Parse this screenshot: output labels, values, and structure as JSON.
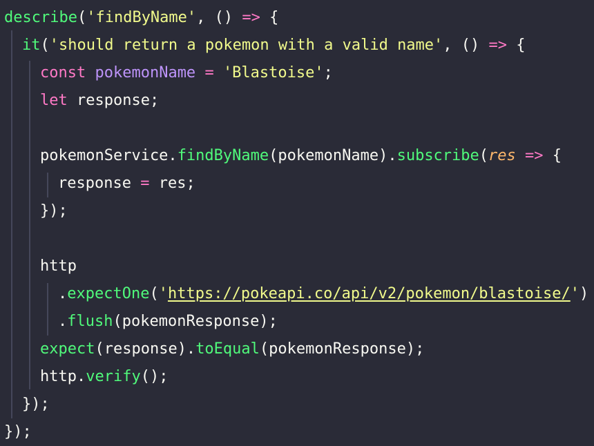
{
  "editor": {
    "language": "javascript",
    "colors": {
      "background": "#2a2b37",
      "plain": "#f8f8f2",
      "function": "#50fa7b",
      "string": "#f1fa8c",
      "keyword": "#ff79c6",
      "variable": "#bd93f9",
      "parameter": "#ffb86c",
      "indent_guide": "#45475a"
    },
    "lines": [
      {
        "tokens": [
          {
            "type": "fn",
            "text": "describe"
          },
          {
            "type": "plain",
            "text": "("
          },
          {
            "type": "str",
            "text": "'findByName'"
          },
          {
            "type": "plain",
            "text": ", () "
          },
          {
            "type": "op",
            "text": "=>"
          },
          {
            "type": "plain",
            "text": " {"
          }
        ]
      },
      {
        "tokens": [
          {
            "type": "fn",
            "text": "it"
          },
          {
            "type": "plain",
            "text": "("
          },
          {
            "type": "str",
            "text": "'should return a pokemon with a valid name'"
          },
          {
            "type": "plain",
            "text": ", () "
          },
          {
            "type": "op",
            "text": "=>"
          },
          {
            "type": "plain",
            "text": " {"
          }
        ]
      },
      {
        "tokens": [
          {
            "type": "kw",
            "text": "const"
          },
          {
            "type": "plain",
            "text": " "
          },
          {
            "type": "var",
            "text": "pokemonName"
          },
          {
            "type": "plain",
            "text": " "
          },
          {
            "type": "op",
            "text": "="
          },
          {
            "type": "plain",
            "text": " "
          },
          {
            "type": "str",
            "text": "'Blastoise'"
          },
          {
            "type": "plain",
            "text": ";"
          }
        ]
      },
      {
        "tokens": [
          {
            "type": "kw",
            "text": "let"
          },
          {
            "type": "plain",
            "text": " response;"
          }
        ]
      },
      {
        "tokens": []
      },
      {
        "tokens": [
          {
            "type": "plain",
            "text": "pokemonService."
          },
          {
            "type": "fn",
            "text": "findByName"
          },
          {
            "type": "plain",
            "text": "(pokemonName)."
          },
          {
            "type": "fn",
            "text": "subscribe"
          },
          {
            "type": "plain",
            "text": "("
          },
          {
            "type": "param",
            "text": "res"
          },
          {
            "type": "plain",
            "text": " "
          },
          {
            "type": "op",
            "text": "=>"
          },
          {
            "type": "plain",
            "text": " {"
          }
        ]
      },
      {
        "tokens": [
          {
            "type": "plain",
            "text": "response "
          },
          {
            "type": "op",
            "text": "="
          },
          {
            "type": "plain",
            "text": " res;"
          }
        ]
      },
      {
        "tokens": [
          {
            "type": "plain",
            "text": "});"
          }
        ]
      },
      {
        "tokens": []
      },
      {
        "tokens": [
          {
            "type": "plain",
            "text": "http"
          }
        ]
      },
      {
        "tokens": [
          {
            "type": "plain",
            "text": "."
          },
          {
            "type": "fn",
            "text": "expectOne"
          },
          {
            "type": "plain",
            "text": "("
          },
          {
            "type": "str",
            "text": "'"
          },
          {
            "type": "url",
            "text": "https://pokeapi.co/api/v2/pokemon/blastoise/"
          },
          {
            "type": "str",
            "text": "'"
          },
          {
            "type": "plain",
            "text": ")"
          }
        ]
      },
      {
        "tokens": [
          {
            "type": "plain",
            "text": "."
          },
          {
            "type": "fn",
            "text": "flush"
          },
          {
            "type": "plain",
            "text": "(pokemonResponse);"
          }
        ]
      },
      {
        "tokens": [
          {
            "type": "fn",
            "text": "expect"
          },
          {
            "type": "plain",
            "text": "(response)."
          },
          {
            "type": "fn",
            "text": "toEqual"
          },
          {
            "type": "plain",
            "text": "(pokemonResponse);"
          }
        ]
      },
      {
        "tokens": [
          {
            "type": "plain",
            "text": "http."
          },
          {
            "type": "fn",
            "text": "verify"
          },
          {
            "type": "plain",
            "text": "();"
          }
        ]
      },
      {
        "tokens": [
          {
            "type": "plain",
            "text": "});"
          }
        ]
      },
      {
        "tokens": [
          {
            "type": "plain",
            "text": "});"
          }
        ]
      }
    ]
  }
}
